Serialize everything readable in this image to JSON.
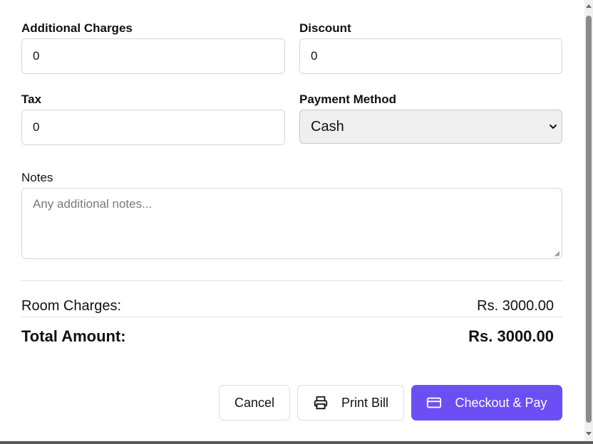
{
  "form": {
    "additional_charges": {
      "label": "Additional Charges",
      "value": "0"
    },
    "discount": {
      "label": "Discount",
      "value": "0"
    },
    "tax": {
      "label": "Tax",
      "value": "0"
    },
    "payment_method": {
      "label": "Payment Method",
      "selected": "Cash"
    },
    "notes": {
      "label": "Notes",
      "placeholder": "Any additional notes..."
    }
  },
  "summary": {
    "room_charges_label": "Room Charges:",
    "room_charges_value": "Rs. 3000.00",
    "total_label": "Total Amount:",
    "total_value": "Rs. 3000.00"
  },
  "actions": {
    "cancel_label": "Cancel",
    "print_label": "Print Bill",
    "checkout_label": "Checkout & Pay"
  },
  "colors": {
    "primary": "#6b4ff5",
    "select_bg": "#efefef",
    "border": "#d6d6dc"
  },
  "icons": [
    "printer-icon",
    "credit-card-icon",
    "chevron-down-icon",
    "resize-grip-icon"
  ]
}
